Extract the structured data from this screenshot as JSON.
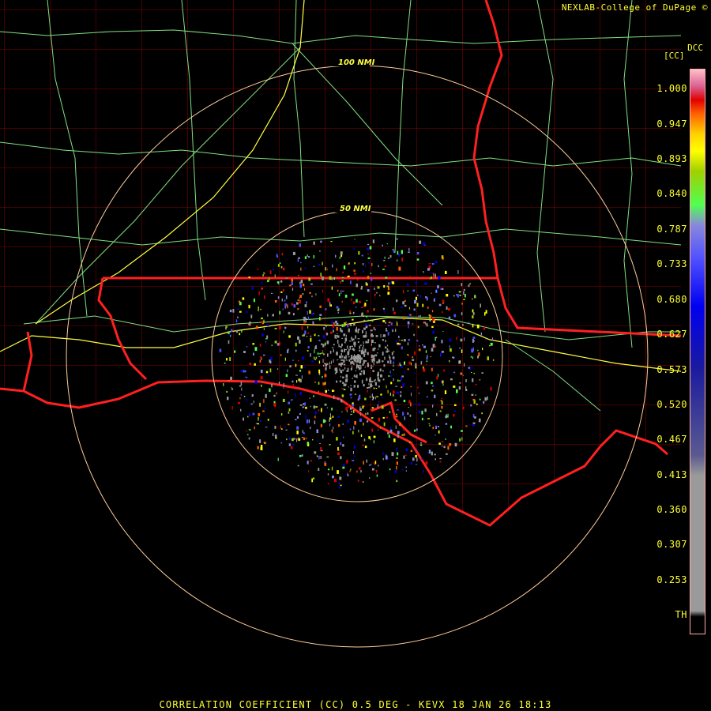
{
  "credit": "NEXLAB-College of DuPage ©",
  "tag": "DCC",
  "product_unit": "[CC]",
  "footer": "CORRELATION COEFFICIENT (CC) 0.5 DEG - KEVX 18 JAN 26 18:13",
  "range_rings": [
    {
      "label": "100 NMI",
      "radius_nmi": 100
    },
    {
      "label": "50 NMI",
      "radius_nmi": 50
    }
  ],
  "color_scale": {
    "labels": [
      "1.000",
      "0.947",
      "0.893",
      "0.840",
      "0.787",
      "0.733",
      "0.680",
      "0.627",
      "0.573",
      "0.520",
      "0.467",
      "0.413",
      "0.360",
      "0.307",
      "0.253",
      "TH"
    ],
    "stops": [
      {
        "value": 1.0,
        "color": "#ffc0cb"
      },
      {
        "value": 0.975,
        "color": "#d86090"
      },
      {
        "value": 0.955,
        "color": "#e00000"
      },
      {
        "value": 0.935,
        "color": "#ff6000"
      },
      {
        "value": 0.905,
        "color": "#ffd000"
      },
      {
        "value": 0.88,
        "color": "#ffff00"
      },
      {
        "value": 0.85,
        "color": "#a0d000"
      },
      {
        "value": 0.8,
        "color": "#50ff50"
      },
      {
        "value": 0.77,
        "color": "#8888dd"
      },
      {
        "value": 0.72,
        "color": "#5050ff"
      },
      {
        "value": 0.65,
        "color": "#0000f0"
      },
      {
        "value": 0.56,
        "color": "#1a1aa0"
      },
      {
        "value": 0.43,
        "color": "#5a5a90"
      },
      {
        "value": 0.4,
        "color": "#9a9a9a"
      },
      {
        "value": 0.2,
        "color": "#9a9a9a"
      }
    ],
    "th_color": "#000000",
    "frame_color": "#ffaaaa",
    "label_color": "#ffff33"
  },
  "map_colors": {
    "state_borders": "#ff2020",
    "county_borders": "#b00000",
    "highways": "#80e080",
    "interstates": "#ffff40",
    "range_rings": "#ffcc99",
    "background": "#000000"
  }
}
